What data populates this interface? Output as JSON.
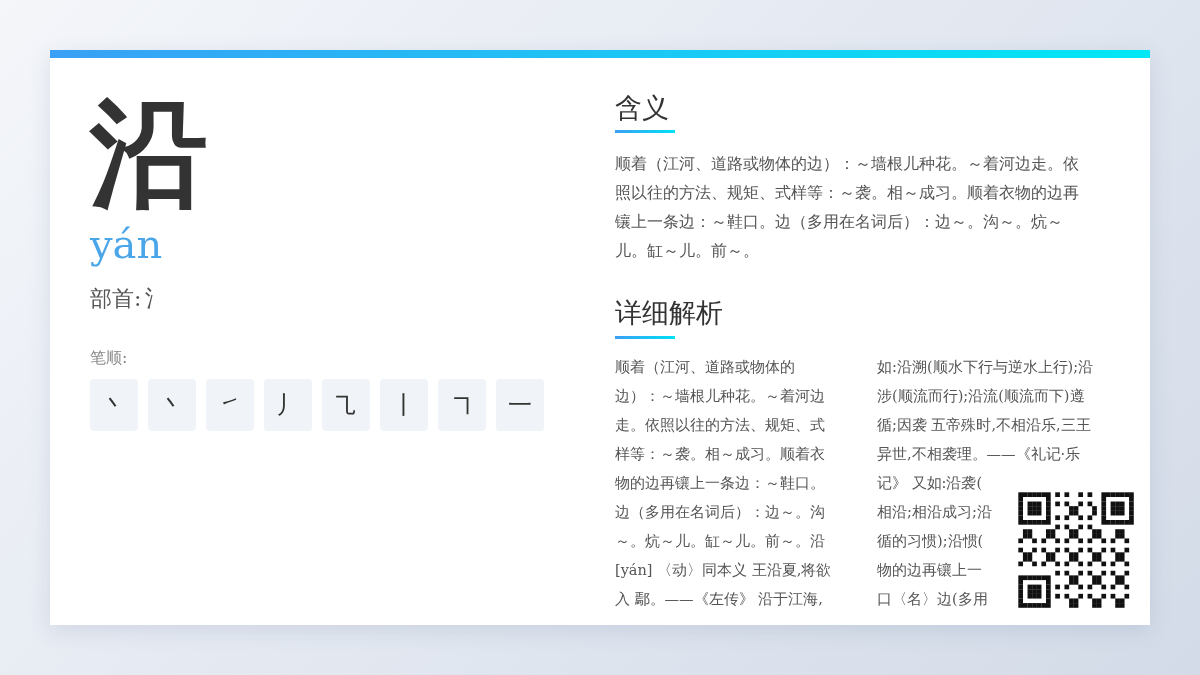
{
  "character": "沿",
  "pinyin": "yán",
  "radical": {
    "label": "部首:",
    "value": "氵"
  },
  "strokes": {
    "label": "笔顺:",
    "items": [
      "丶",
      "丶",
      "㇀",
      "丿",
      "㇈",
      "丨",
      "㇕",
      "一"
    ]
  },
  "meaning": {
    "title": "含义",
    "text": "顺着（江河、道路或物体的边）：～墙根儿种花。～着河边走。依照以往的方法、规矩、式样等：～袭。相～成习。顺着衣物的边再镶上一条边：～鞋口。边（多用在名词后）：边～。沟～。炕～儿。缸～儿。前～。"
  },
  "detail": {
    "title": "详细解析",
    "column_1": [
      "顺着（江河、道路或物体的",
      "边）：～墙根儿种花。～着河边",
      "走。依照以往的方法、规矩、式",
      "样等：～袭。相～成习。顺着衣",
      "物的边再镶上一条边：～鞋口。",
      "边（多用在名词后）：边～。沟",
      "～。炕～儿。缸～儿。前～。沿",
      "[yán] 〈动〉同本义 王沿夏,将欲",
      "入 鄢。——《左传》 沿于江海,"
    ],
    "column_2": [
      "如:沿溯(顺水下行与逆水上行);沿",
      "涉(顺流而行);沿流(顺流而下)遵",
      "循;因袭 五帝殊时,不相沿乐,三王",
      "异世,不相袭理。——《礼记·乐",
      "记》 又如:沿袭(",
      "相沿;相沿成习;沿",
      "循的习惯);沿惯(",
      "物的边再镶上一",
      "口〈名〉边(多用"
    ]
  }
}
